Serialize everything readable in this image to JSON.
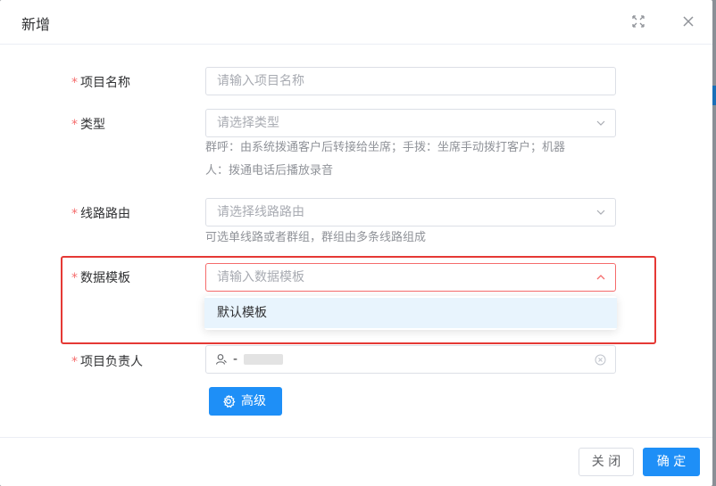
{
  "dialog": {
    "title": "新增",
    "fullscreen_icon": "fullscreen-icon",
    "close_icon": "close-icon"
  },
  "form": {
    "project_name": {
      "label": "项目名称",
      "required_mark": "*",
      "placeholder": "请输入项目名称",
      "value": ""
    },
    "type": {
      "label": "类型",
      "required_mark": "*",
      "placeholder": "请选择类型",
      "hint_line1": "群呼：由系统拨通客户后转接给坐席；手拨：坐席手动拨打客户；机器",
      "hint_line2": "人：拨通电话后播放录音"
    },
    "route": {
      "label": "线路路由",
      "required_mark": "*",
      "placeholder": "请选择线路路由",
      "hint": "可选单线路或者群组，群组由多条线路组成"
    },
    "data_template": {
      "label": "数据模板",
      "required_mark": "*",
      "placeholder": "请输入数据模板",
      "options": [
        "默认模板"
      ]
    },
    "owner": {
      "label": "项目负责人",
      "required_mark": "*",
      "value": "-"
    }
  },
  "advanced_button": {
    "label": "高级",
    "icon": "gear-icon"
  },
  "footer": {
    "close_label": "关 闭",
    "ok_label": "确 定"
  },
  "colors": {
    "primary": "#1e8ff7",
    "required": "#f56c6c",
    "highlight_box": "#e53935",
    "option_hover": "#e8f4fd"
  }
}
